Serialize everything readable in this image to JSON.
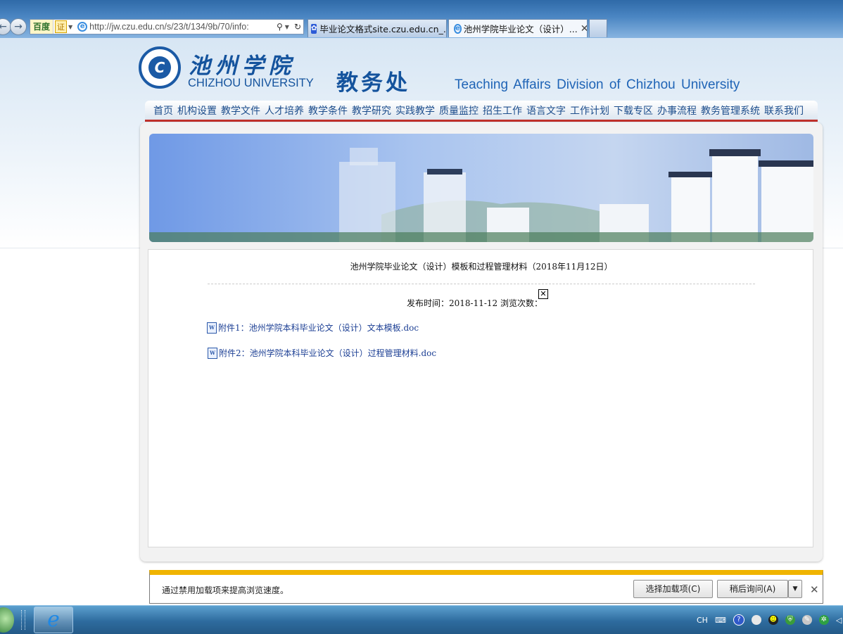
{
  "browser": {
    "address": {
      "search_label": "百度",
      "cert_label": "证",
      "url": "http://jw.czu.edu.cn/s/23/t/134/9b/70/info:",
      "search_icon": "⚲",
      "refresh_icon": "↻"
    },
    "tabs": [
      {
        "title": "毕业论文格式site.czu.edu.cn_...",
        "icon": "paw-icon",
        "active": false
      },
      {
        "title": "池州学院毕业论文（设计）...",
        "icon": "ie-icon",
        "active": true
      }
    ],
    "tab_close": "✕"
  },
  "site": {
    "logo_cn": "池州学院",
    "logo_en": "CHIZHOU UNIVERSITY",
    "logo_mark": "C",
    "dept_cn": "教务处",
    "dept_en": "Teaching Affairs Division of Chizhou University",
    "nav": [
      "首页",
      "机构设置",
      "教学文件",
      "人才培养",
      "教学条件",
      "教学研究",
      "实践教学",
      "质量监控",
      "招生工作",
      "语言文字",
      "工作计划",
      "下载专区",
      "办事流程",
      "教务管理系统",
      "联系我们"
    ]
  },
  "article": {
    "title": "池州学院毕业论文（设计）模板和过程管理材料（2018年11月12日）",
    "meta": "发布时间：2018-11-12 浏览次数：",
    "broken_image": "✕",
    "attachments": [
      {
        "label": "附件1：池州学院本科毕业论文（设计）文本模板.doc"
      },
      {
        "label": "附件2：池州学院本科毕业论文（设计）过程管理材料.doc"
      }
    ]
  },
  "notification": {
    "message": "通过禁用加载项来提高浏览速度。",
    "choose_button": "选择加载项(C)",
    "later_button": "稍后询问(A)",
    "dropdown": "▼",
    "close": "✕"
  },
  "taskbar": {
    "ie_glyph": "e",
    "lang": "CH",
    "keyboard": "⌨",
    "help": "?"
  },
  "colors": {
    "brand": "#14539d",
    "nav_underline": "#c0302a",
    "notify_bar": "#f0b400"
  }
}
